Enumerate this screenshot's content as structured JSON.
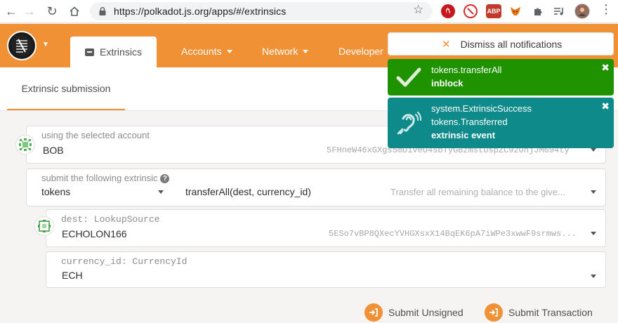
{
  "browser": {
    "url": "https://polkadot.js.org/apps/#/extrinsics",
    "extensions": [
      {
        "name": "ublock-icon",
        "label": "",
        "color": "#c8161d"
      },
      {
        "name": "block-icon",
        "label": "",
        "color": "#d32f2f"
      },
      {
        "name": "adblock-plus-icon",
        "label": "ABP",
        "color": "#c0392b"
      },
      {
        "name": "metamask-fox-icon",
        "label": "",
        "color": "#e2761b"
      },
      {
        "name": "puzzle-extensions-icon",
        "label": "",
        "color": "#5f6368"
      },
      {
        "name": "media-playlist-icon",
        "label": "",
        "color": "#5f6368"
      },
      {
        "name": "profile-avatar",
        "label": "",
        "color": "#8d6e63"
      }
    ]
  },
  "header": {
    "active_tab": "Extrinsics",
    "nav": {
      "accounts": "Accounts",
      "network": "Network",
      "developer": "Developer"
    }
  },
  "subheader": {
    "tab": "Extrinsic submission"
  },
  "form": {
    "account": {
      "label": "using the selected account",
      "name": "BOB",
      "address": "5FHneW46xGXgs5mUiveU4sbTyGBzmstUspZC92UhjJM694ty"
    },
    "extrinsic": {
      "label": "submit the following extrinsic",
      "module": "tokens",
      "call": "transferAll(dest, currency_id)",
      "description": "Transfer all remaining balance to the give..."
    },
    "dest": {
      "label": "dest: LookupSource",
      "name": "ECHOLON166",
      "address": "5ESo7vBP8QXecYVHGXsxX14BqEK6pA7iWPe3xwwF9srmws..."
    },
    "currency": {
      "label": "currency_id: CurrencyId",
      "value": "ECH"
    }
  },
  "actions": {
    "unsigned": "Submit Unsigned",
    "transaction": "Submit Transaction"
  },
  "notifications": {
    "dismiss_all": "Dismiss all notifications",
    "success": {
      "title": "tokens.transferAll",
      "status": "inblock"
    },
    "event": {
      "line1": "system.ExtrinsicSuccess",
      "line2": "tokens.Transferred",
      "status": "extrinsic event"
    }
  },
  "colors": {
    "accent": "#f19135",
    "success": "#1f9200",
    "event": "#0f8a8a"
  }
}
